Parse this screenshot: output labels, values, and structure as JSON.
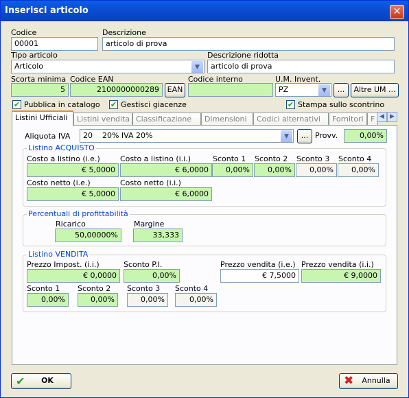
{
  "window": {
    "title": "Inserisci articolo",
    "close_glyph": "✕"
  },
  "fields": {
    "codice": {
      "label": "Codice",
      "value": "00001"
    },
    "descrizione": {
      "label": "Descrizione",
      "value": "articolo di prova"
    },
    "tipo": {
      "label": "Tipo articolo",
      "value": "Articolo"
    },
    "descr_ridotta": {
      "label": "Descrizione ridotta",
      "value": "articolo di prova"
    },
    "scorta": {
      "label": "Scorta minima",
      "value": "5"
    },
    "ean": {
      "label": "Codice EAN",
      "value": "2100000000289",
      "button": "EAN"
    },
    "interno": {
      "label": "Codice interno",
      "value": ""
    },
    "um": {
      "label": "U.M. Invent.",
      "value": "PZ",
      "dots": "...",
      "altre": "Altre UM ..."
    }
  },
  "checks": {
    "pubblica": {
      "label": "Pubblica in catalogo",
      "checked": true
    },
    "giacenze": {
      "label": "Gestisci giacenze",
      "checked": true
    },
    "scontrino": {
      "label": "Stampa sullo scontrino",
      "checked": true
    },
    "mark": "✔"
  },
  "tabs": [
    "Listini Ufficiali",
    "Listini vendita",
    "Classificazione",
    "Dimensioni",
    "Codici alternativi",
    "Fornitori",
    "F"
  ],
  "tab_scroll": {
    "left": "◀",
    "right": "▶"
  },
  "iva": {
    "label": "Aliquota IVA",
    "value": "20    20% IVA 20%",
    "dots": "...",
    "provv_label": "Provv.",
    "provv_value": "0,00%"
  },
  "acquisto": {
    "title": "Listino ACQUISTO",
    "costo_ie_label": "Costo a listino (i.e.)",
    "costo_ie": "€ 5,0000",
    "costo_ii_label": "Costo a listino (i.i.)",
    "costo_ii": "€ 6,0000",
    "sconti": [
      {
        "label": "Sconto 1",
        "value": "0,00%"
      },
      {
        "label": "Sconto 2",
        "value": "0,00%"
      },
      {
        "label": "Sconto 3",
        "value": "0,00%"
      },
      {
        "label": "Sconto 4",
        "value": "0,00%"
      }
    ],
    "netto_ie_label": "Costo netto (i.e.)",
    "netto_ie": "€ 5,0000",
    "netto_ii_label": "Costo netto (i.i.)",
    "netto_ii": "€ 6,0000"
  },
  "profitto": {
    "title": "Percentuali di profittabilità",
    "ricarico_label": "Ricarico",
    "ricarico": "50,00000%",
    "margine_label": "Margine",
    "margine": "33,333"
  },
  "vendita": {
    "title": "Listino VENDITA",
    "prezzo_imp_label": "Prezzo Impost. (i.i.)",
    "prezzo_imp": "€ 0,0000",
    "sconto_pi_label": "Sconto P.I.",
    "sconto_pi": "0,00%",
    "pv_ie_label": "Prezzo vendita (i.e.)",
    "pv_ie": "€ 7,5000",
    "pv_ii_label": "Prezzo vendita (i.i.)",
    "pv_ii": "€ 9,0000",
    "sconti": [
      {
        "label": "Sconto 1",
        "value": "0,00%"
      },
      {
        "label": "Sconto 2",
        "value": "0,00%"
      },
      {
        "label": "Sconto 3",
        "value": "0,00%"
      },
      {
        "label": "Sconto 4",
        "value": "0,00%"
      }
    ]
  },
  "buttons": {
    "ok": "OK",
    "annulla": "Annulla"
  }
}
